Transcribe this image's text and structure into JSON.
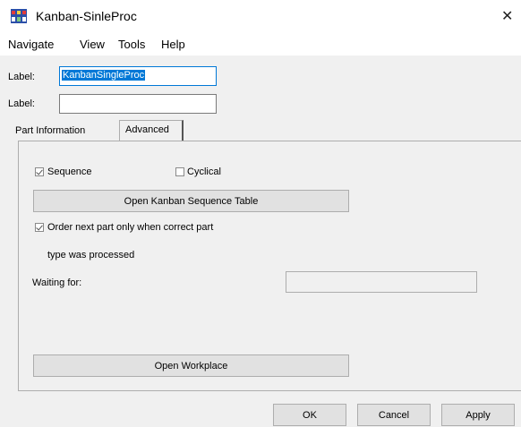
{
  "window": {
    "title": "Kanban-SinleProc",
    "close_glyph": "✕"
  },
  "menu": [
    "Navigate",
    "View",
    "Tools",
    "Help"
  ],
  "fields": [
    {
      "label": "Label:",
      "value": "KanbanSingleProc"
    },
    {
      "label": "Label:",
      "value": ""
    }
  ],
  "tabs": {
    "inactive": "Part Information",
    "active": "Advanced"
  },
  "advanced": {
    "sequence_label": "Sequence",
    "sequence_checked": true,
    "cyclical_label": "Cyclical",
    "cyclical_checked": false,
    "open_table_button": "Open Kanban Sequence Table",
    "order_next_line1": "Order next part only when correct part",
    "order_next_line2": "type was processed",
    "order_next_checked": true,
    "waiting_for_label": "Waiting for:",
    "waiting_for_value": "",
    "open_workplace_button": "Open Workplace"
  },
  "buttons": {
    "ok": "OK",
    "cancel": "Cancel",
    "apply": "Apply"
  },
  "icons": {
    "app": "kanban-app-icon",
    "close": "close-icon",
    "checkbox": "checkbox-icon"
  },
  "colors": {
    "selection": "#0078d7",
    "dialog_bg": "#f0f0f0"
  }
}
